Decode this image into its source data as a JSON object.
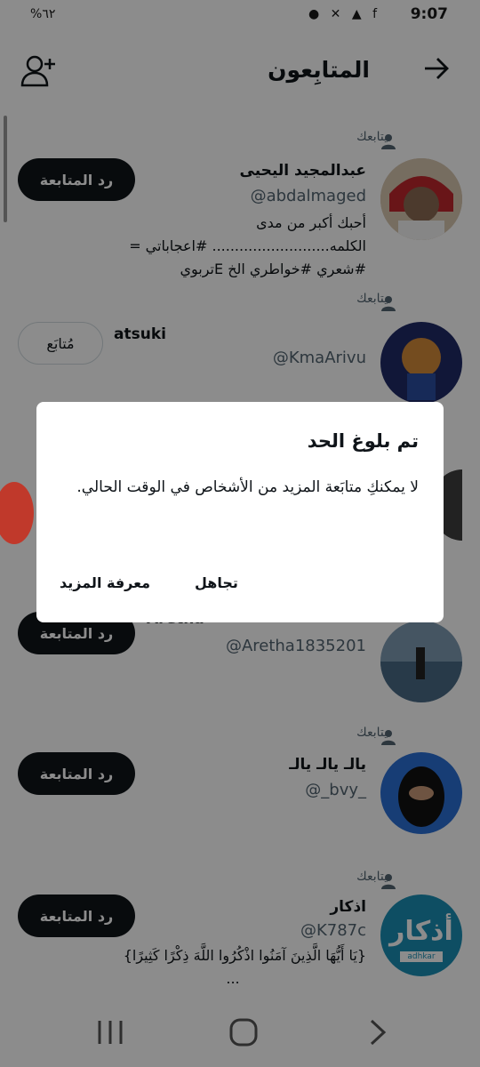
{
  "status_bar": {
    "time": "9:07",
    "battery": "%٦٢",
    "icons_right": "● ✕ ▲ f"
  },
  "header": {
    "title": "المتابِعون"
  },
  "colors": {
    "accent": "#0f1419",
    "secondary_text": "#536471",
    "border": "#cfd9de"
  },
  "rows": [
    {
      "follows_you": "يتابعك",
      "name": "عبدالمجيد اليحيى",
      "handle": "@abdalmaged",
      "bio_line1": "أحبك أكبر من مدى الكلمه.......................... #اعجاباتي =",
      "bio_line2": "#شعري #خواطري الخ Eتربوي",
      "button": "رد المتابعة"
    },
    {
      "follows_you": "يتابعك",
      "name": "atsuki",
      "handle": "@KmaArivu",
      "button": "مُتابَع"
    },
    {
      "name": "Aretha",
      "handle": "@Aretha1835201",
      "button": "رد المتابعة"
    },
    {
      "follows_you": "يتابعك",
      "name": "يالـ يالـ يالـ",
      "handle": "@_bvy_",
      "button": "رد المتابعة"
    },
    {
      "follows_you": "يتابعك",
      "name": "اذكار",
      "handle": "@K787c",
      "bio_line1": "{يَا أَيُّهَا الَّذِينَ آمَنُوا اذْكُرُوا اللَّهَ ذِكْرًا كَثِيرًا}",
      "bio_line2": "...",
      "button": "رد المتابعة",
      "logo_text": "أذكار",
      "logo_sub": "adhkar"
    }
  ],
  "dialog": {
    "title": "تم بلوغ الحد",
    "body": "لا يمكنكِ متابَعة المزيد من الأشخاص في الوقت الحالي.",
    "ignore": "تجاهل",
    "learn_more": "معرفة المزيد"
  }
}
